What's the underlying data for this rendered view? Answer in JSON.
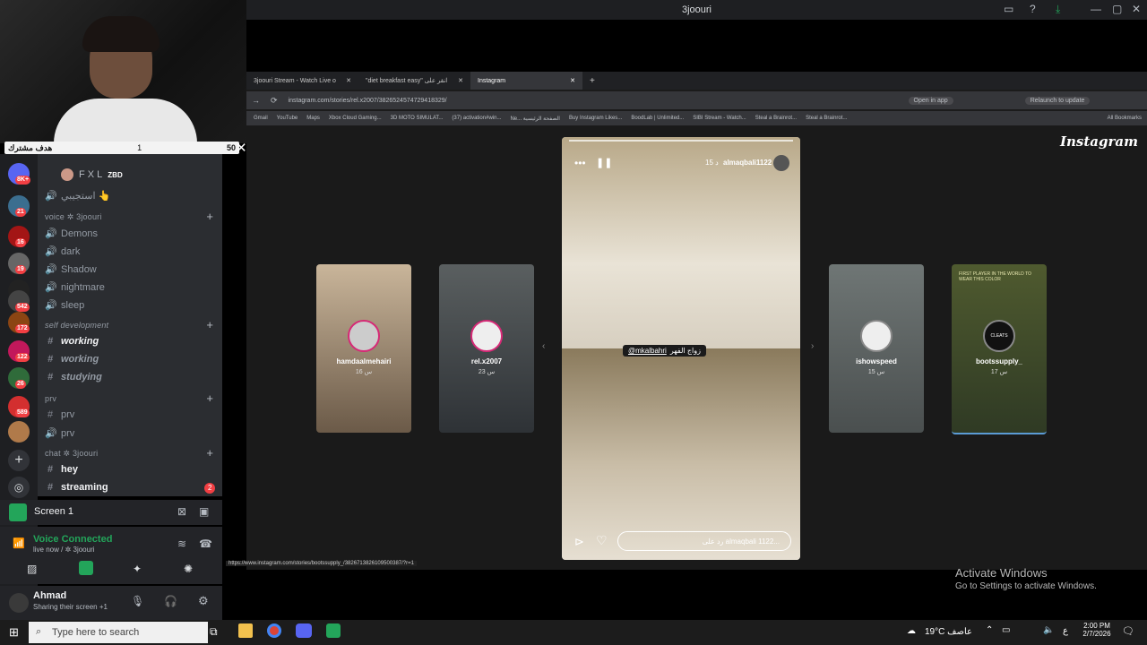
{
  "window": {
    "title": "3joouri"
  },
  "goal_bar": {
    "label": "هدف مشترك",
    "current": "1",
    "target": "50"
  },
  "servers": [
    {
      "badge": "8K+"
    },
    {
      "badge": "21"
    },
    {
      "badge": "16"
    },
    {
      "badge": "19"
    },
    {
      "badge": ""
    },
    {
      "badge": "542"
    },
    {
      "badge": "172"
    },
    {
      "badge": "122"
    },
    {
      "badge": "26"
    },
    {
      "badge": "589"
    },
    {
      "badge": ""
    }
  ],
  "channels": {
    "top_user": "F X L",
    "top_user_tag": "ZBD",
    "top_voice": "استجيبي 👆",
    "voice_category": "voice ✲ 3joouri",
    "voice_channels": [
      "Demons",
      "dark",
      "Shadow",
      "nightmare",
      "sleep"
    ],
    "self_category": "self development",
    "self_channels": [
      "working",
      "working",
      "studying"
    ],
    "prv_category": "prv",
    "prv_channels": [
      "prv",
      "prv"
    ],
    "chat_category": "chat ✲ 3joouri",
    "chat_channels": [
      "hey",
      "streaming"
    ],
    "streaming_badge": "2"
  },
  "screen_panel": {
    "label": "Screen 1"
  },
  "voice_panel": {
    "status": "Voice Connected",
    "detail": "live now / ✲ 3joouri"
  },
  "user_panel": {
    "name": "Ahmad",
    "status": "Sharing their screen +1"
  },
  "browser": {
    "tabs": [
      {
        "label": "3joouri Stream - Watch Live o"
      },
      {
        "label": "\"diet breakfast easy\" انقر على"
      },
      {
        "label": "Instagram"
      }
    ],
    "url": "instagram.com/stories/rel.x2007/3826524574729418329/",
    "open_in_app": "Open in app",
    "relaunch": "Relaunch to update",
    "bookmarks": [
      "Gmail",
      "YouTube",
      "Maps",
      "Xbox Cloud Gaming...",
      "3D MOTO SIMULAT...",
      "(37) activation#win...",
      "Ne... الصفحة الرئيسية",
      "Buy Instagram Likes...",
      "BoodLab | Unlimited...",
      "SIBI Stream - Watch...",
      "Steal a Brainrot...",
      "Steal a Brainrot..."
    ],
    "all_bookmarks": "All Bookmarks",
    "status_url": "https://www.instagram.com/stories/bootssupply_/3826713826109500387/?r=1"
  },
  "instagram": {
    "logo": "Instagram",
    "main_story": {
      "user": "almaqbali1122",
      "time": "15 د",
      "caption_tag": "@mkalbahri",
      "caption_text": "زواج الفهر",
      "reply_placeholder": "رد على almaqbali 1122..."
    },
    "stories": [
      {
        "user": "hamdaalmehairi",
        "time": "16 س"
      },
      {
        "user": "rel.x2007",
        "time": "23 س"
      },
      {
        "user": "ishowspeed",
        "time": "15 س"
      },
      {
        "user": "bootssupply_",
        "time": "17 س",
        "overlay": "FIRST PLAYER IN THE WORLD TO WEAR THIS COLOR",
        "brand": "CLEATS"
      }
    ]
  },
  "watermark": {
    "title": "Activate Windows",
    "subtitle": "Go to Settings to activate Windows."
  },
  "taskbar": {
    "search_placeholder": "Type here to search",
    "weather": "19°C عاصف",
    "lang": "ع",
    "time": "2:00 PM",
    "date": "2/7/2026"
  }
}
